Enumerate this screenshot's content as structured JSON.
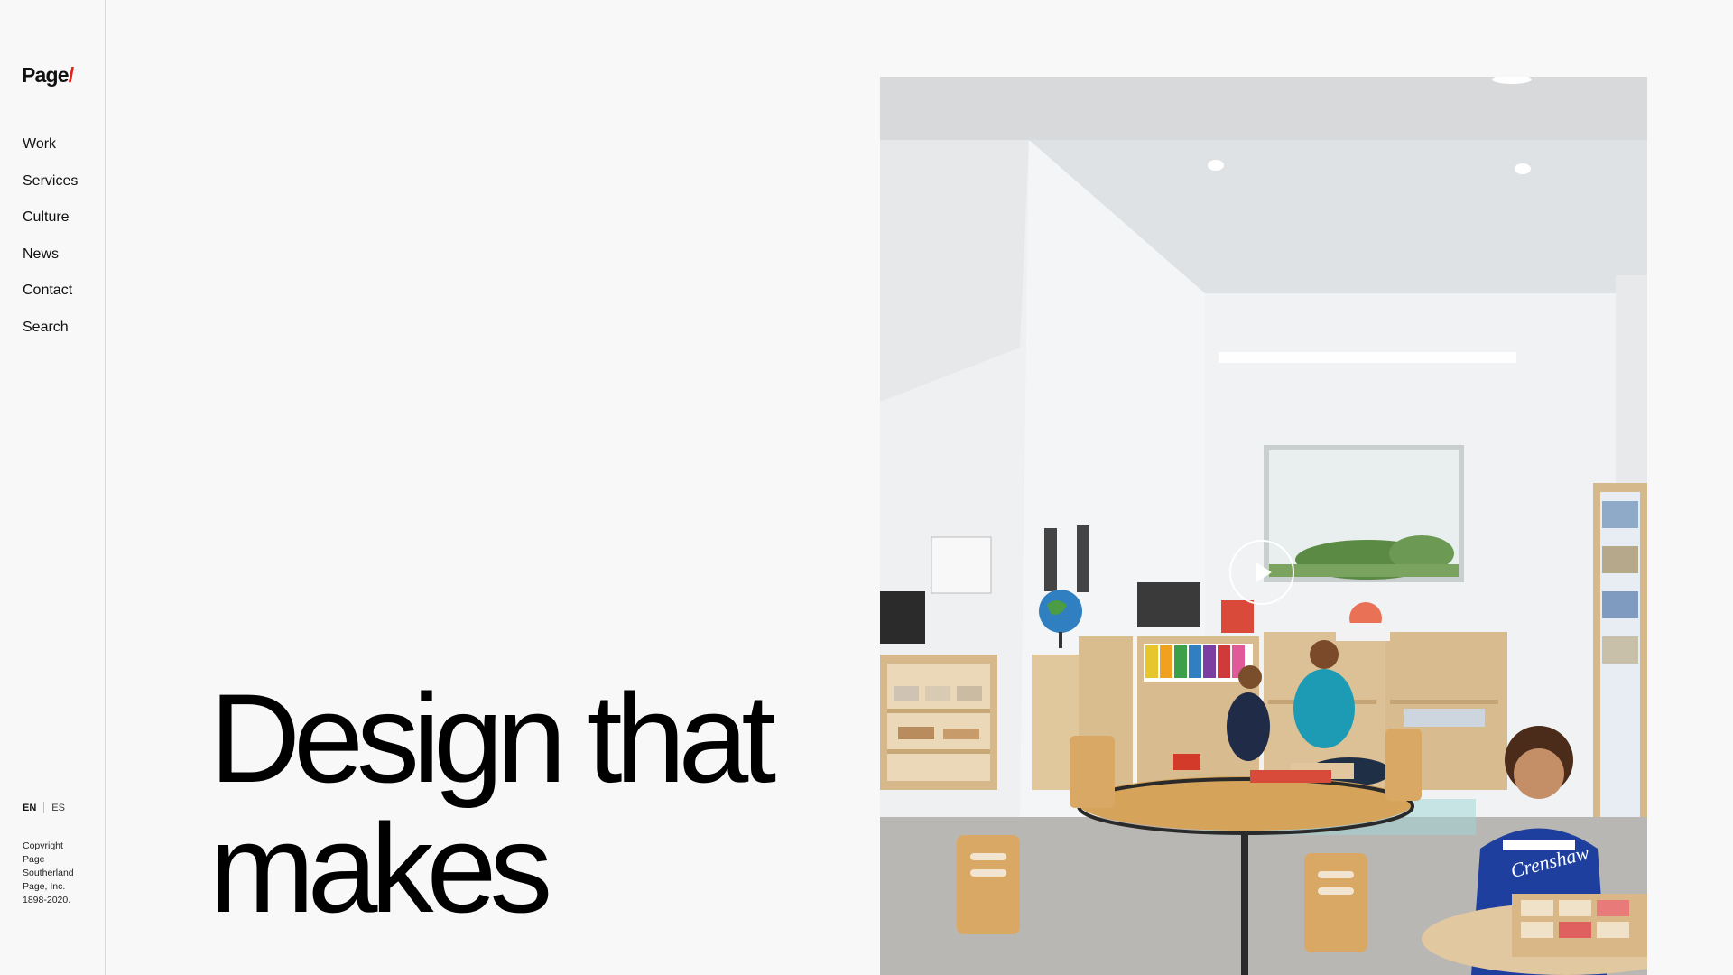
{
  "brand": {
    "name": "Page",
    "slash": "/",
    "accent_color": "#e2231a"
  },
  "nav": {
    "items": [
      {
        "label": "Work"
      },
      {
        "label": "Services"
      },
      {
        "label": "Culture"
      },
      {
        "label": "News"
      },
      {
        "label": "Contact"
      },
      {
        "label": "Search"
      }
    ]
  },
  "language": {
    "active": "EN",
    "other": "ES"
  },
  "footer": {
    "copyright_lines": [
      "Copyright",
      "Page",
      "Southerland",
      "Page, Inc.",
      "1898-2020."
    ]
  },
  "hero": {
    "headline_lines": [
      "Design that",
      "makes"
    ],
    "image_icon": "play-icon",
    "shirt_text": "Crenshaw"
  }
}
